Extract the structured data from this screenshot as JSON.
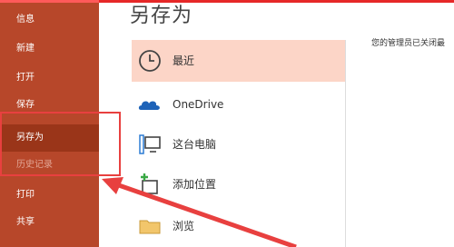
{
  "sidebar": {
    "items": [
      {
        "label": "信息"
      },
      {
        "label": "新建"
      },
      {
        "label": "打开"
      },
      {
        "label": "保存"
      },
      {
        "label": "另存为"
      },
      {
        "label": "历史记录"
      },
      {
        "label": "打印"
      },
      {
        "label": "共享"
      }
    ]
  },
  "main": {
    "title": "另存为",
    "locations": [
      {
        "label": "最近",
        "icon": "clock-icon"
      },
      {
        "label": "OneDrive",
        "icon": "cloud-icon"
      },
      {
        "label": "这台电脑",
        "icon": "computer-icon"
      },
      {
        "label": "添加位置",
        "icon": "add-location-icon"
      },
      {
        "label": "浏览",
        "icon": "folder-icon"
      }
    ],
    "notice": "您的管理员已关闭最"
  },
  "colors": {
    "sidebar_bg": "#b7472a",
    "sidebar_selected": "#9a3519",
    "recent_highlight": "#fcd5c7",
    "annotation_red": "#e8403f"
  }
}
